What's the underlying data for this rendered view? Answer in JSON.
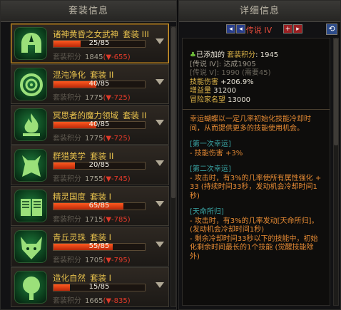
{
  "left_panel": {
    "title": "套装信息"
  },
  "right_panel": {
    "title": "详细信息"
  },
  "sets": [
    {
      "name": "诸神黄昏之女武神",
      "level": "套装 III",
      "progress": "25/85",
      "fill": 0.294,
      "score_label": "套装积分",
      "score": "1845",
      "delta": "(▼-655)",
      "icon": "helmet-icon",
      "selected": true
    },
    {
      "name": "混沌净化",
      "level": "套装 II",
      "progress": "40/85",
      "fill": 0.47,
      "score_label": "套装积分",
      "score": "1775",
      "delta": "(▼-725)",
      "icon": "spiral-icon",
      "selected": false
    },
    {
      "name": "冥思者的魔力领域",
      "level": "套装 II",
      "progress": "40/85",
      "fill": 0.47,
      "score_label": "套装积分",
      "score": "1775",
      "delta": "(▼-725)",
      "icon": "flame-icon",
      "selected": false
    },
    {
      "name": "群猎美学",
      "level": "套装 II",
      "progress": "20/85",
      "fill": 0.235,
      "score_label": "套装积分",
      "score": "1755",
      "delta": "(▼-745)",
      "icon": "wolf-icon",
      "selected": false
    },
    {
      "name": "精灵国度",
      "level": "套装 I",
      "progress": "65/85",
      "fill": 0.765,
      "score_label": "套装积分",
      "score": "1715",
      "delta": "(▼-785)",
      "icon": "book-icon",
      "selected": false
    },
    {
      "name": "青丘灵珠",
      "level": "套装 I",
      "progress": "55/85",
      "fill": 0.647,
      "score_label": "套装积分",
      "score": "1705",
      "delta": "(▼-795)",
      "icon": "fox-icon",
      "selected": false
    },
    {
      "name": "造化自然",
      "level": "套装 I",
      "progress": "15/85",
      "fill": 0.176,
      "score_label": "套装积分",
      "score": "1665",
      "delta": "(▼-835)",
      "icon": "tree-icon",
      "selected": false
    }
  ],
  "detail": {
    "prev_icon": "◂",
    "prev2_icon": "◂",
    "tier": "传说 IV",
    "next_icon": "+",
    "next2_icon": "▸",
    "refresh_icon": "⟲",
    "added_prefix": "已添加的",
    "score_label": "套装积分",
    "score": ": 1945",
    "legend4_tag": "[传说 IV]",
    "legend4_status": ": 达成1905",
    "legend5_tag": "[传说 V]",
    "legend5_status": ": 1990 (需要45)",
    "stats": [
      {
        "label": "技能伤害",
        "value": " +206.9%"
      },
      {
        "label": "增益量",
        "value": " 31200"
      },
      {
        "label": "冒险家名望",
        "value": " 13000"
      }
    ],
    "description": "幸运蝴蝶以一定几率初始化技能冷却时间，从而提供更多的技能使用机会。",
    "lucky1_title": "[第一次幸运]",
    "lucky1_text": "- 技能伤害 +3%",
    "lucky2_title": "[第二次幸运]",
    "lucky2_text": "- 攻击时，有3%的几率使所有属性强化 +33 (持续时间33秒，发动机会冷却时间1秒)",
    "fate_title": "[天命所归]",
    "fate_text1": "- 攻击时，有3%的几率发动[天命所归]。(发动机会冷却时间1秒)",
    "fate_text2": "- 剩余冷却时间33秒以下的技能中，初始化剩余时间最长的1个技能 (觉醒技能除外)"
  }
}
